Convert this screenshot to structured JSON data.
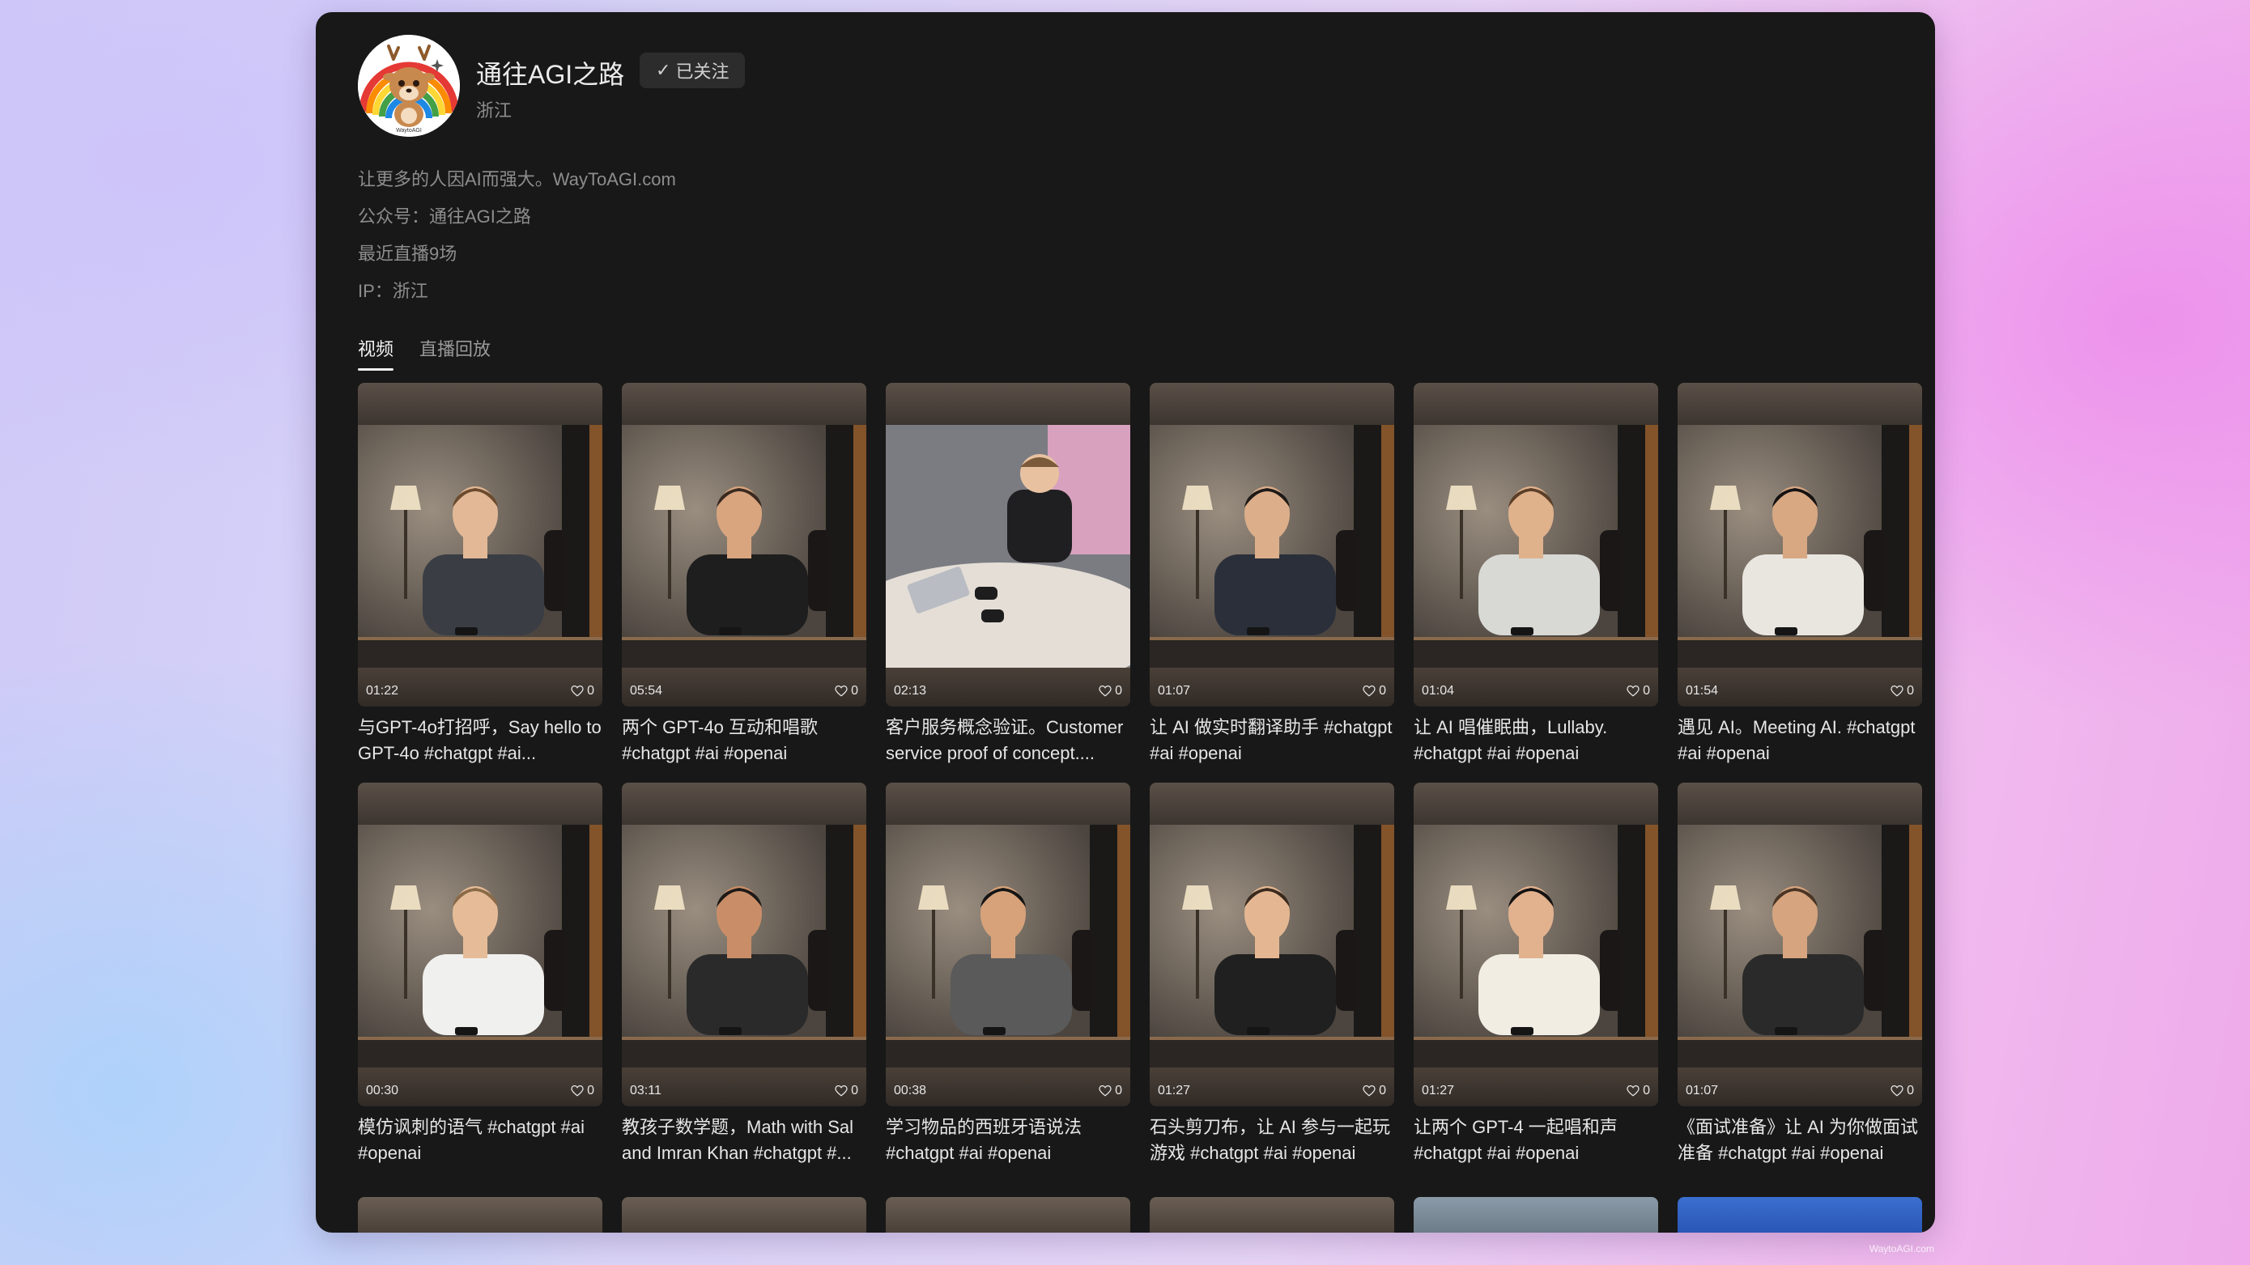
{
  "profile": {
    "name": "通往AGI之路",
    "follow_label": "已关注",
    "location": "浙江",
    "bio": [
      "让更多的人因AI而强大。WayToAGI.com",
      "公众号：通往AGI之路",
      "最近直播9场",
      "IP：浙江"
    ],
    "avatar_text": "WaytoAGI"
  },
  "tabs": [
    {
      "label": "视频",
      "active": true
    },
    {
      "label": "直播回放",
      "active": false
    }
  ],
  "videos": [
    {
      "duration": "01:22",
      "likes": "0",
      "title": "与GPT-4o打招呼，Say hello to GPT-4o #chatgpt #ai..."
    },
    {
      "duration": "05:54",
      "likes": "0",
      "title": "两个 GPT-4o 互动和唱歌 #chatgpt #ai #openai"
    },
    {
      "duration": "02:13",
      "likes": "0",
      "title": "客户服务概念验证。Customer service proof of concept...."
    },
    {
      "duration": "01:07",
      "likes": "0",
      "title": "让 AI 做实时翻译助手 #chatgpt #ai #openai"
    },
    {
      "duration": "01:04",
      "likes": "0",
      "title": "让 AI 唱催眠曲，Lullaby. #chatgpt #ai #openai"
    },
    {
      "duration": "01:54",
      "likes": "0",
      "title": "遇见 AI。Meeting AI. #chatgpt #ai #openai"
    },
    {
      "duration": "00:30",
      "likes": "0",
      "title": "模仿讽刺的语气 #chatgpt #ai #openai"
    },
    {
      "duration": "03:11",
      "likes": "0",
      "title": "教孩子数学题，Math with Sal and Imran Khan #chatgpt #..."
    },
    {
      "duration": "00:38",
      "likes": "0",
      "title": "学习物品的西班牙语说法 #chatgpt #ai #openai"
    },
    {
      "duration": "01:27",
      "likes": "0",
      "title": "石头剪刀布，让 AI 参与一起玩游戏 #chatgpt #ai #openai"
    },
    {
      "duration": "01:27",
      "likes": "0",
      "title": "让两个 GPT-4 一起唱和声 #chatgpt #ai #openai"
    },
    {
      "duration": "01:07",
      "likes": "0",
      "title": "《面试准备》让 AI 为你做面试准备 #chatgpt #ai #openai"
    }
  ],
  "watermark": "WaytoAGI.com",
  "colors": {
    "window_bg": "#181818",
    "text_primary": "#ececec",
    "text_secondary": "#8d8d8d",
    "follow_bg": "#2c2c2c"
  }
}
